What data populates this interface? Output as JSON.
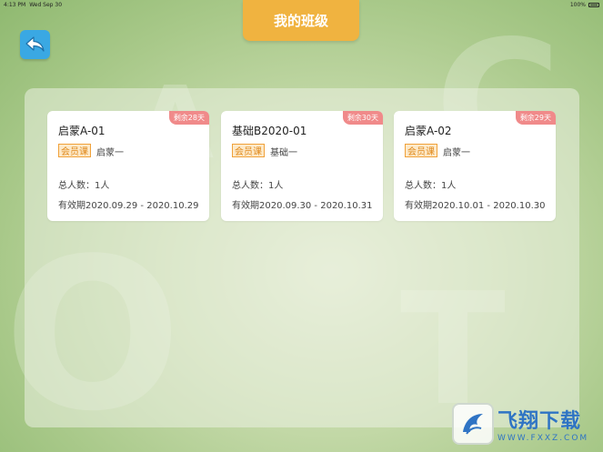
{
  "status_bar": {
    "time": "4:13 PM",
    "date": "Wed Sep 30",
    "battery": "100%"
  },
  "header": {
    "title": "我的班级"
  },
  "background_letters": [
    "C",
    "O",
    "A",
    "T"
  ],
  "classes": [
    {
      "name": "启蒙A-01",
      "remaining": "剩余28天",
      "type_tag": "会员课",
      "level": "启蒙一",
      "count": "总人数：1人",
      "validity": "有效期2020.09.29 - 2020.10.29"
    },
    {
      "name": "基础B2020-01",
      "remaining": "剩余30天",
      "type_tag": "会员课",
      "level": "基础一",
      "count": "总人数：1人",
      "validity": "有效期2020.09.30 - 2020.10.31"
    },
    {
      "name": "启蒙A-02",
      "remaining": "剩余29天",
      "type_tag": "会员课",
      "level": "启蒙一",
      "count": "总人数：1人",
      "validity": "有效期2020.10.01 - 2020.10.30"
    }
  ],
  "watermark": {
    "title": "飞翔下载",
    "subtitle": "WWW.FXXZ.COM"
  },
  "colors": {
    "accent": "#f0b340",
    "back_button": "#3aa8e3",
    "badge": "#f08a8a",
    "tag_border": "#f0a13a"
  }
}
